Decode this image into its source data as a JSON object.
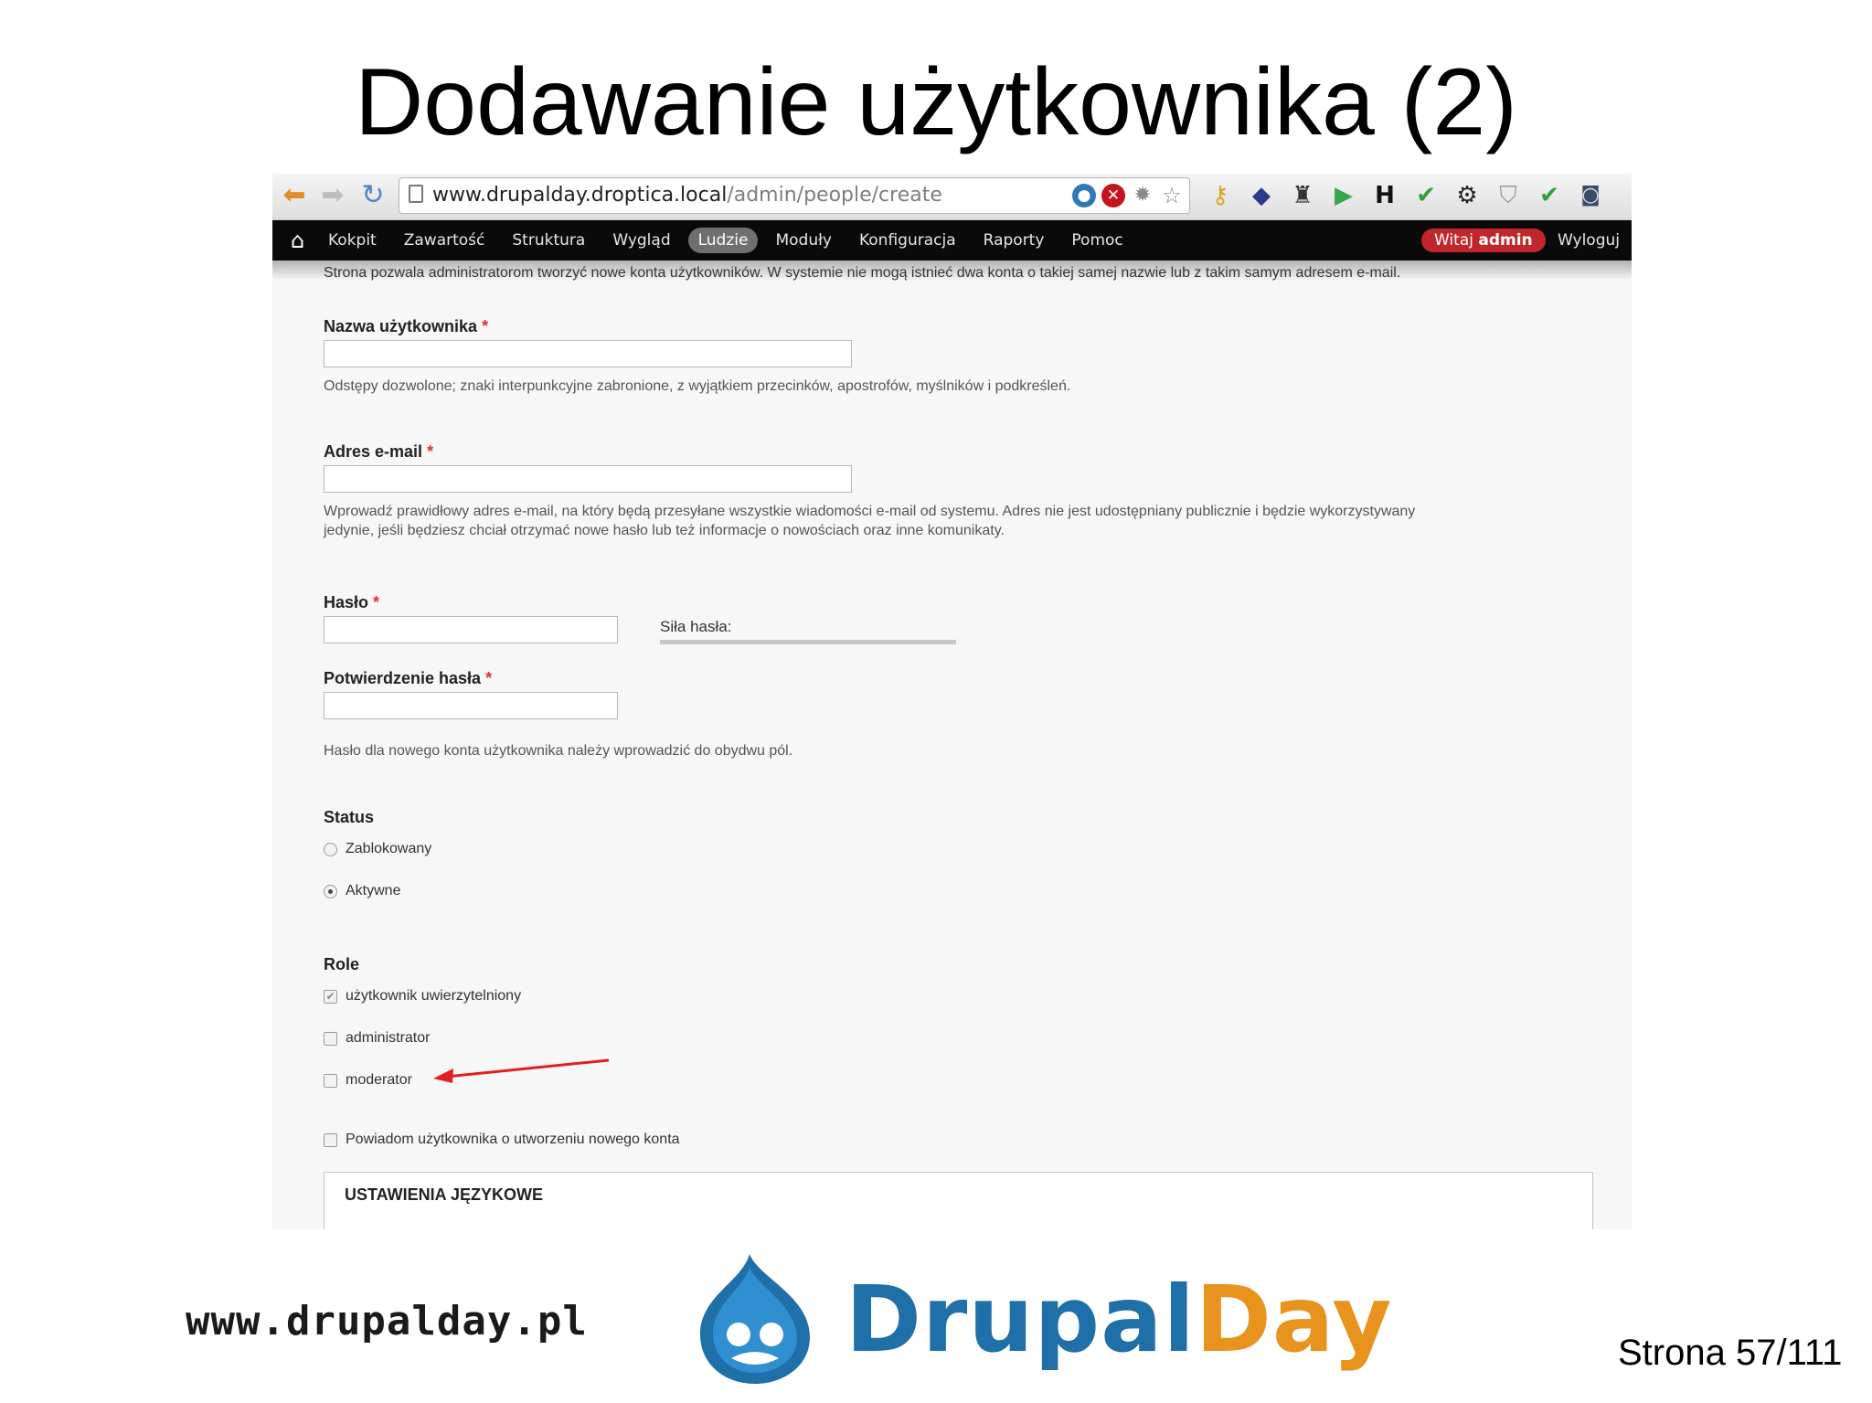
{
  "slide": {
    "title": "Dodawanie użytkownika (2)",
    "footer_url": "www.drupalday.pl",
    "brand_part1": "Drupal",
    "brand_part2": "Day",
    "page_number": "Strona 57/111"
  },
  "browser": {
    "url_host": "www.drupalday.droptica.local",
    "url_path": "/admin/people/create"
  },
  "toolbar": {
    "items": [
      "Kokpit",
      "Zawartość",
      "Struktura",
      "Wygląd",
      "Ludzie",
      "Moduły",
      "Konfiguracja",
      "Raporty",
      "Pomoc"
    ],
    "active_item": "Ludzie",
    "welcome_text": "Witaj",
    "welcome_user": "admin",
    "logout": "Wyloguj"
  },
  "form": {
    "intro": "Strona pozwala administratorom tworzyć nowe konta użytkowników. W systemie nie mogą istnieć dwa konta o takiej samej nazwie lub z takim samym adresem e-mail.",
    "required_mark": "*",
    "username": {
      "label": "Nazwa użytkownika",
      "value": "",
      "description": "Odstępy dozwolone; znaki interpunkcyjne zabronione, z wyjątkiem przecinków, apostrofów, myślników i podkreśleń."
    },
    "email": {
      "label": "Adres e-mail",
      "value": "",
      "description_line1": "Wprowadź prawidłowy adres e-mail, na który będą przesyłane wszystkie wiadomości e-mail od systemu. Adres nie jest udostępniany publicznie i będzie wykorzystywany",
      "description_line2": "jedynie, jeśli będziesz chciał otrzymać nowe hasło lub też informacje o nowościach oraz inne komunikaty."
    },
    "password": {
      "label": "Hasło",
      "value": "",
      "strength_label": "Siła hasła:",
      "confirm_label": "Potwierdzenie hasła",
      "description": "Hasło dla nowego konta użytkownika należy wprowadzić do obydwu pól."
    },
    "status": {
      "label": "Status",
      "options": [
        "Zablokowany",
        "Aktywne"
      ],
      "selected": "Aktywne"
    },
    "roles": {
      "label": "Role",
      "items": [
        {
          "label": "użytkownik uwierzytelniony",
          "checked": true,
          "disabled": true
        },
        {
          "label": "administrator",
          "checked": false
        },
        {
          "label": "moderator",
          "checked": false
        }
      ]
    },
    "notify": {
      "label": "Powiadom użytkownika o utworzeniu nowego konta",
      "checked": false
    },
    "language_settings": "USTAWIENIA JĘZYKOWE"
  },
  "icons": {
    "browser": [
      "back-arrow-icon",
      "forward-arrow-icon",
      "reload-icon",
      "page-icon",
      "drupal-icon",
      "error-icon",
      "gear-icon",
      "star-icon"
    ],
    "extensions": [
      "key-icon",
      "speedometer-icon",
      "stamp-icon",
      "play-icon",
      "h-icon",
      "check-icon",
      "gear-icon",
      "shield-icon",
      "check-icon",
      "camera-icon"
    ]
  },
  "colors": {
    "annotation_arrow": "#e02020",
    "welcome_badge": "#c0272d",
    "brand_blue": "#1f6fa9",
    "brand_orange": "#e8931e"
  }
}
